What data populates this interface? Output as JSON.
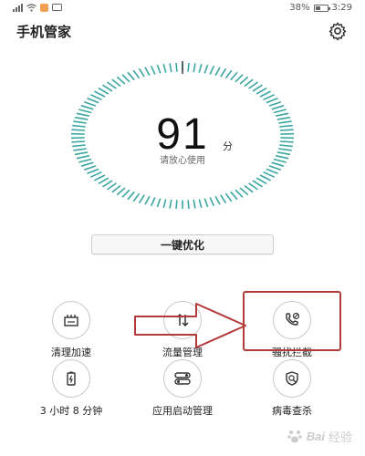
{
  "status_bar": {
    "battery_text": "38%",
    "time": "3:29"
  },
  "header": {
    "title": "手机管家"
  },
  "score": {
    "value": "91",
    "unit": "分",
    "caption": "请放心使用"
  },
  "optimize_label": "一键优化",
  "tools": [
    {
      "label": "清理加速",
      "icon": "storage-icon"
    },
    {
      "label": "流量管理",
      "icon": "data-traffic-icon"
    },
    {
      "label": "骚扰拦截",
      "icon": "phone-block-icon"
    },
    {
      "label": "3 小时 8 分钟",
      "icon": "battery-icon"
    },
    {
      "label": "应用启动管理",
      "icon": "app-launch-icon"
    },
    {
      "label": "病毒查杀",
      "icon": "virus-scan-icon"
    }
  ],
  "colors": {
    "gauge_tick": "#3aa7a0",
    "highlight": "#b33a3a"
  },
  "watermark": {
    "brand": "Bai",
    "suffix": "经验"
  }
}
